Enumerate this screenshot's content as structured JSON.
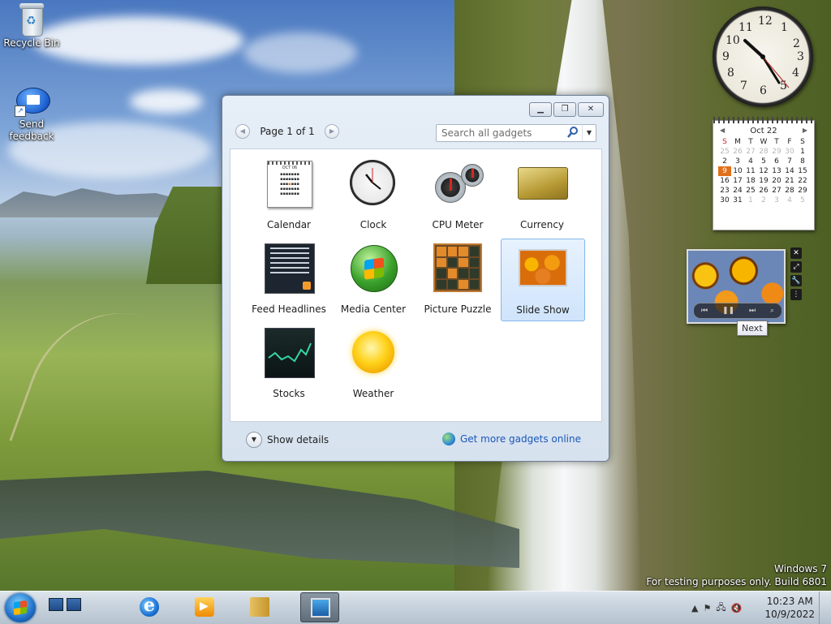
{
  "desktop": {
    "icons": [
      {
        "label": "Recycle Bin",
        "icon": "recycle-bin-icon"
      },
      {
        "label": "Send feedback",
        "icon": "feedback-icon"
      }
    ],
    "watermark": {
      "line1": "Windows 7",
      "line2": "For testing purposes only. Build 6801"
    }
  },
  "gallery": {
    "title_buttons": [
      "minimize",
      "restore",
      "close"
    ],
    "page_label": "Page 1 of 1",
    "search_placeholder": "Search all gadgets",
    "gadgets": [
      {
        "label": "Calendar",
        "icon": "calendar-icon"
      },
      {
        "label": "Clock",
        "icon": "clock-icon"
      },
      {
        "label": "CPU Meter",
        "icon": "cpu-meter-icon"
      },
      {
        "label": "Currency",
        "icon": "currency-icon"
      },
      {
        "label": "Feed Headlines",
        "icon": "feed-headlines-icon"
      },
      {
        "label": "Media Center",
        "icon": "media-center-icon"
      },
      {
        "label": "Picture Puzzle",
        "icon": "picture-puzzle-icon"
      },
      {
        "label": "Slide Show",
        "icon": "slide-show-icon",
        "selected": true
      },
      {
        "label": "Stocks",
        "icon": "stocks-icon"
      },
      {
        "label": "Weather",
        "icon": "weather-icon"
      }
    ],
    "show_details": "Show details",
    "get_more": "Get more gadgets online",
    "calendar_thumb_month": "OCT 06"
  },
  "clock_gadget": {
    "numbers": [
      "12",
      "1",
      "2",
      "3",
      "4",
      "5",
      "6",
      "7",
      "8",
      "9",
      "10",
      "11"
    ],
    "time": "10:23"
  },
  "calendar_gadget": {
    "month": "Oct 22",
    "weekdays": [
      "S",
      "M",
      "T",
      "W",
      "T",
      "F",
      "S"
    ],
    "weeks": [
      [
        "25",
        "26",
        "27",
        "28",
        "29",
        "30",
        "1"
      ],
      [
        "2",
        "3",
        "4",
        "5",
        "6",
        "7",
        "8"
      ],
      [
        "9",
        "10",
        "11",
        "12",
        "13",
        "14",
        "15"
      ],
      [
        "16",
        "17",
        "18",
        "19",
        "20",
        "21",
        "22"
      ],
      [
        "23",
        "24",
        "25",
        "26",
        "27",
        "28",
        "29"
      ],
      [
        "30",
        "31",
        "1",
        "2",
        "3",
        "4",
        "5"
      ]
    ],
    "today": "9"
  },
  "slideshow_gadget": {
    "tooltip": "Next",
    "controls": [
      "previous",
      "pause",
      "next",
      "view"
    ]
  },
  "taskbar": {
    "clock_time": "10:23 AM",
    "clock_date": "10/9/2022",
    "pinned": [
      "internet-explorer-icon",
      "media-player-icon",
      "explorer-icon",
      "gadget-gallery-icon"
    ],
    "tray_icons": [
      "tray-expand-icon",
      "action-center-icon",
      "network-icon",
      "volume-muted-icon"
    ],
    "colors": {
      "selection": "#cfe4fb",
      "link": "#1a57b8",
      "today": "#e2701a"
    }
  }
}
